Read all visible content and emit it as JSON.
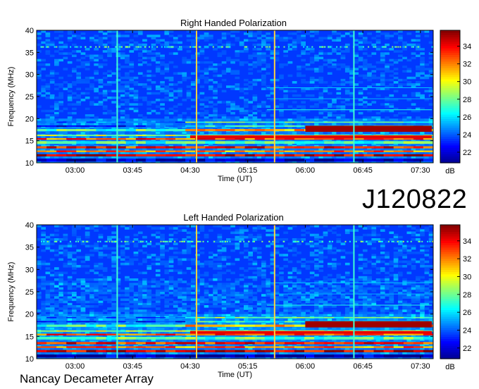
{
  "figure_title": "J120822",
  "footer_text": "Nancay Decameter Array",
  "colormap": [
    "#00008f",
    "#0000ff",
    "#0080ff",
    "#00ffff",
    "#80ff80",
    "#ffff00",
    "#ff8000",
    "#ff0000",
    "#800000"
  ],
  "chart_data": [
    {
      "type": "heatmap",
      "title": "Right Handed Polarization",
      "xlabel": "Time (UT)",
      "ylabel": "Frequency (MHz)",
      "x_ticks": [
        "03:00",
        "03:45",
        "04:30",
        "05:15",
        "06:00",
        "06:45",
        "07:30"
      ],
      "x_tick_minutes": [
        180,
        225,
        270,
        315,
        360,
        405,
        450
      ],
      "xlim_minutes": [
        150,
        460
      ],
      "y_ticks": [
        10,
        15,
        20,
        25,
        30,
        35,
        40
      ],
      "ylim": [
        10,
        40
      ],
      "colorbar": {
        "label": "dB",
        "ticks": [
          22,
          24,
          26,
          28,
          30,
          32,
          34
        ],
        "range": [
          20.8,
          35.8
        ]
      },
      "vertical_lines": [
        {
          "time_minutes": 213,
          "color": "#40ffd0"
        },
        {
          "time_minutes": 275,
          "color": "#ffd040"
        },
        {
          "time_minutes": 336,
          "color": "#ffd040"
        },
        {
          "time_minutes": 398,
          "color": "#40ffd0"
        }
      ]
    },
    {
      "type": "heatmap",
      "title": "Left Handed Polarization",
      "xlabel": "Time (UT)",
      "ylabel": "Frequency (MHz)",
      "x_ticks": [
        "03:00",
        "03:45",
        "04:30",
        "05:15",
        "06:00",
        "06:45",
        "07:30"
      ],
      "x_tick_minutes": [
        180,
        225,
        270,
        315,
        360,
        405,
        450
      ],
      "xlim_minutes": [
        150,
        460
      ],
      "y_ticks": [
        10,
        15,
        20,
        25,
        30,
        35,
        40
      ],
      "ylim": [
        10,
        40
      ],
      "colorbar": {
        "label": "dB",
        "ticks": [
          22,
          24,
          26,
          28,
          30,
          32,
          34
        ],
        "range": [
          20.8,
          35.8
        ]
      },
      "vertical_lines": [
        {
          "time_minutes": 213,
          "color": "#40ffd0"
        },
        {
          "time_minutes": 275,
          "color": "#ffd040"
        },
        {
          "time_minutes": 336,
          "color": "#ffd040"
        },
        {
          "time_minutes": 398,
          "color": "#40ffd0"
        }
      ]
    }
  ]
}
